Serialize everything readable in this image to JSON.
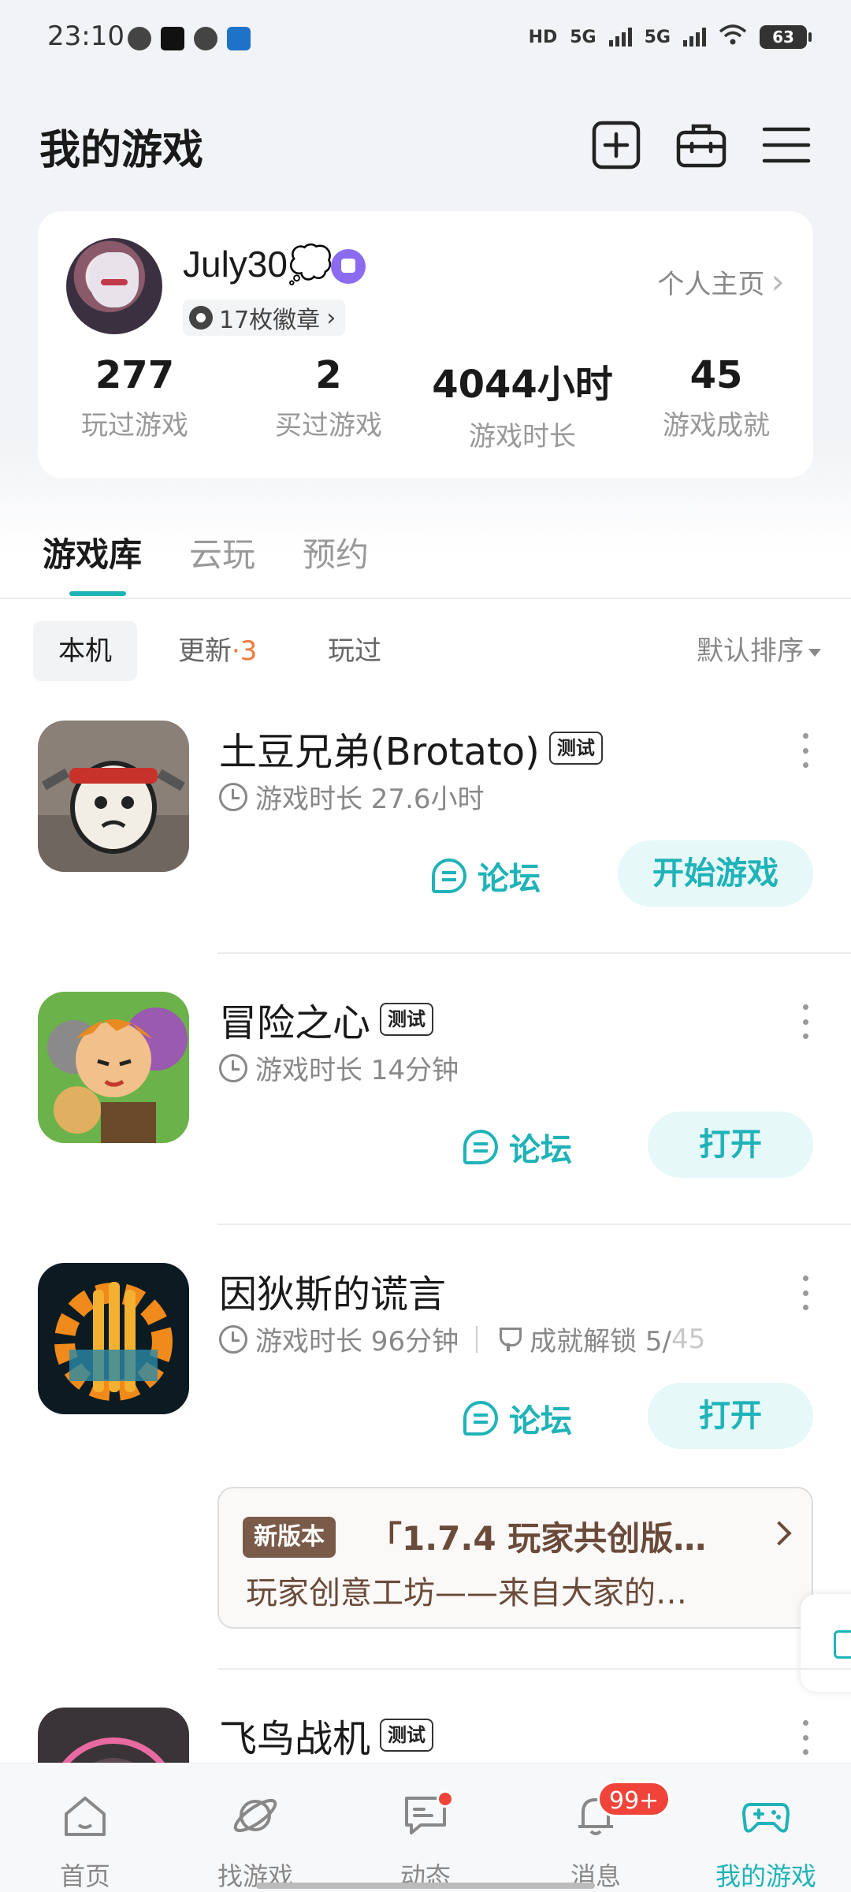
{
  "status_bar": {
    "time": "23:10",
    "network_label_1": "5G",
    "network_label_2": "5G",
    "hd_label": "HD",
    "battery": "63"
  },
  "header": {
    "title": "我的游戏"
  },
  "profile": {
    "username": "July30💭",
    "badges": "17枚徽章",
    "homepage_link": "个人主页",
    "stats": [
      {
        "value": "277",
        "label": "玩过游戏"
      },
      {
        "value": "2",
        "label": "买过游戏"
      },
      {
        "value": "4044小时",
        "label": "游戏时长"
      },
      {
        "value": "45",
        "label": "游戏成就"
      }
    ]
  },
  "tabs": [
    {
      "label": "游戏库",
      "active": true
    },
    {
      "label": "云玩",
      "active": false
    },
    {
      "label": "预约",
      "active": false
    }
  ],
  "filters": {
    "local": "本机",
    "update": "更新",
    "update_count": "·3",
    "played": "玩过",
    "sort": "默认排序"
  },
  "games": [
    {
      "name": "土豆兄弟(Brotato)",
      "tag": "测试",
      "playtime": "游戏时长 27.6小时",
      "forum": "论坛",
      "action": "开始游戏"
    },
    {
      "name": "冒险之心",
      "tag": "测试",
      "playtime": "游戏时长 14分钟",
      "forum": "论坛",
      "action": "打开"
    },
    {
      "name": "因狄斯的谎言",
      "playtime": "游戏时长 96分钟",
      "achievement_label": "成就解锁 5/",
      "achievement_total": "45",
      "forum": "论坛",
      "action": "打开"
    },
    {
      "name": "飞鸟战机",
      "tag": "测试"
    }
  ],
  "news": {
    "badge": "新版本",
    "title": "「1.7.4 玩家共创版…",
    "subtitle": "玩家创意工坊——来自大家的…"
  },
  "bottom_nav": [
    {
      "label": "首页",
      "icon": "home-icon"
    },
    {
      "label": "找游戏",
      "icon": "planet-icon"
    },
    {
      "label": "动态",
      "icon": "chat-icon"
    },
    {
      "label": "消息",
      "icon": "bell-icon",
      "badge": "99+"
    },
    {
      "label": "我的游戏",
      "icon": "gamepad-icon",
      "active": true
    }
  ],
  "colors": {
    "accent": "#1fb3b8",
    "badge_red": "#f0443a",
    "update_orange": "#f07a3a",
    "news_brown": "#7a5a48"
  }
}
